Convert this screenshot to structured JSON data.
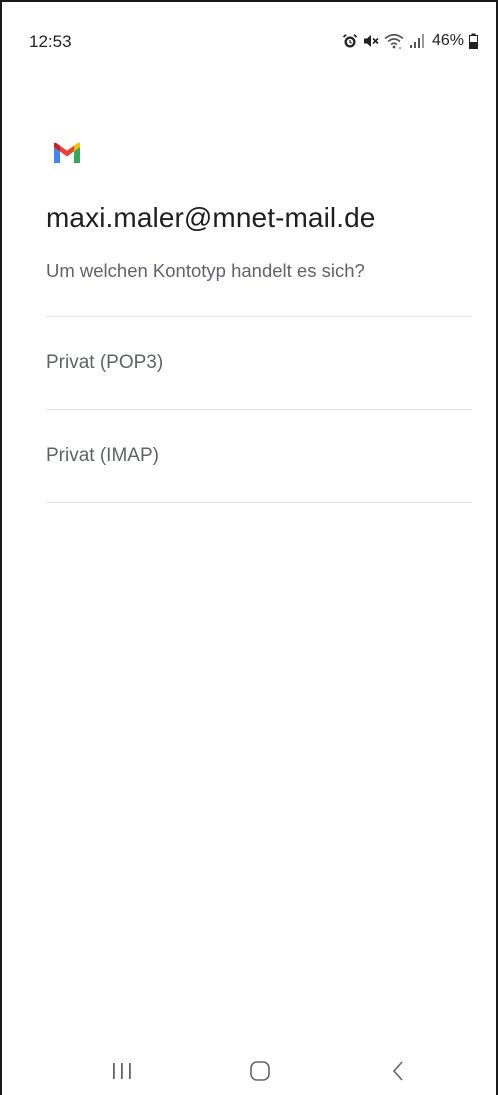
{
  "status_bar": {
    "time": "12:53",
    "battery_percent": "46%",
    "icons": [
      "alarm-icon",
      "mute-icon",
      "wifi-icon",
      "signal-icon",
      "battery-icon"
    ]
  },
  "app": {
    "logo_icon": "gmail-logo-icon",
    "brand_colors": [
      "#4285F4",
      "#EA4335",
      "#FBBC04",
      "#34A853",
      "#C5221F"
    ]
  },
  "header": {
    "email": "maxi.maler@mnet-mail.de",
    "question": "Um welchen Kontotyp handelt es sich?"
  },
  "options": [
    {
      "label": "Privat (POP3)"
    },
    {
      "label": "Privat (IMAP)"
    }
  ],
  "nav_bar": {
    "icons": [
      "recents-icon",
      "home-icon",
      "back-icon"
    ]
  }
}
